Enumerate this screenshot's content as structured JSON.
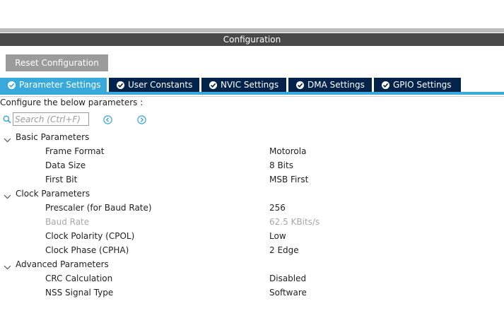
{
  "header": {
    "title": "Configuration"
  },
  "toolbar": {
    "reset_label": "Reset Configuration"
  },
  "tabs": [
    {
      "label": "Parameter Settings",
      "active": true
    },
    {
      "label": "User Constants",
      "active": false
    },
    {
      "label": "NVIC Settings",
      "active": false
    },
    {
      "label": "DMA Settings",
      "active": false
    },
    {
      "label": "GPIO Settings",
      "active": false
    }
  ],
  "instruction": "Configure the below parameters :",
  "search": {
    "placeholder": "Search (Ctrl+F)",
    "value": ""
  },
  "icons": {
    "search": "search-icon",
    "prev": "chevron-left-circle-icon",
    "next": "chevron-right-circle-icon",
    "expand": "chevron-down-icon",
    "check": "check-circle-icon"
  },
  "colors": {
    "header_bar": "#484848",
    "tab_active": "#39a9dc",
    "tab_inactive": "#03234b",
    "button": "#9b9b9b",
    "disabled_text": "#a8a8a8"
  },
  "groups": [
    {
      "label": "Basic Parameters",
      "params": [
        {
          "name": "Frame Format",
          "value": "Motorola",
          "disabled": false
        },
        {
          "name": "Data Size",
          "value": "8 Bits",
          "disabled": false
        },
        {
          "name": "First Bit",
          "value": "MSB First",
          "disabled": false
        }
      ]
    },
    {
      "label": "Clock Parameters",
      "params": [
        {
          "name": "Prescaler (for Baud Rate)",
          "value": "256",
          "disabled": false
        },
        {
          "name": "Baud Rate",
          "value": "62.5 KBits/s",
          "disabled": true
        },
        {
          "name": "Clock Polarity (CPOL)",
          "value": "Low",
          "disabled": false
        },
        {
          "name": "Clock Phase (CPHA)",
          "value": "2 Edge",
          "disabled": false
        }
      ]
    },
    {
      "label": "Advanced Parameters",
      "params": [
        {
          "name": "CRC Calculation",
          "value": "Disabled",
          "disabled": false
        },
        {
          "name": "NSS Signal Type",
          "value": "Software",
          "disabled": false
        }
      ]
    }
  ]
}
